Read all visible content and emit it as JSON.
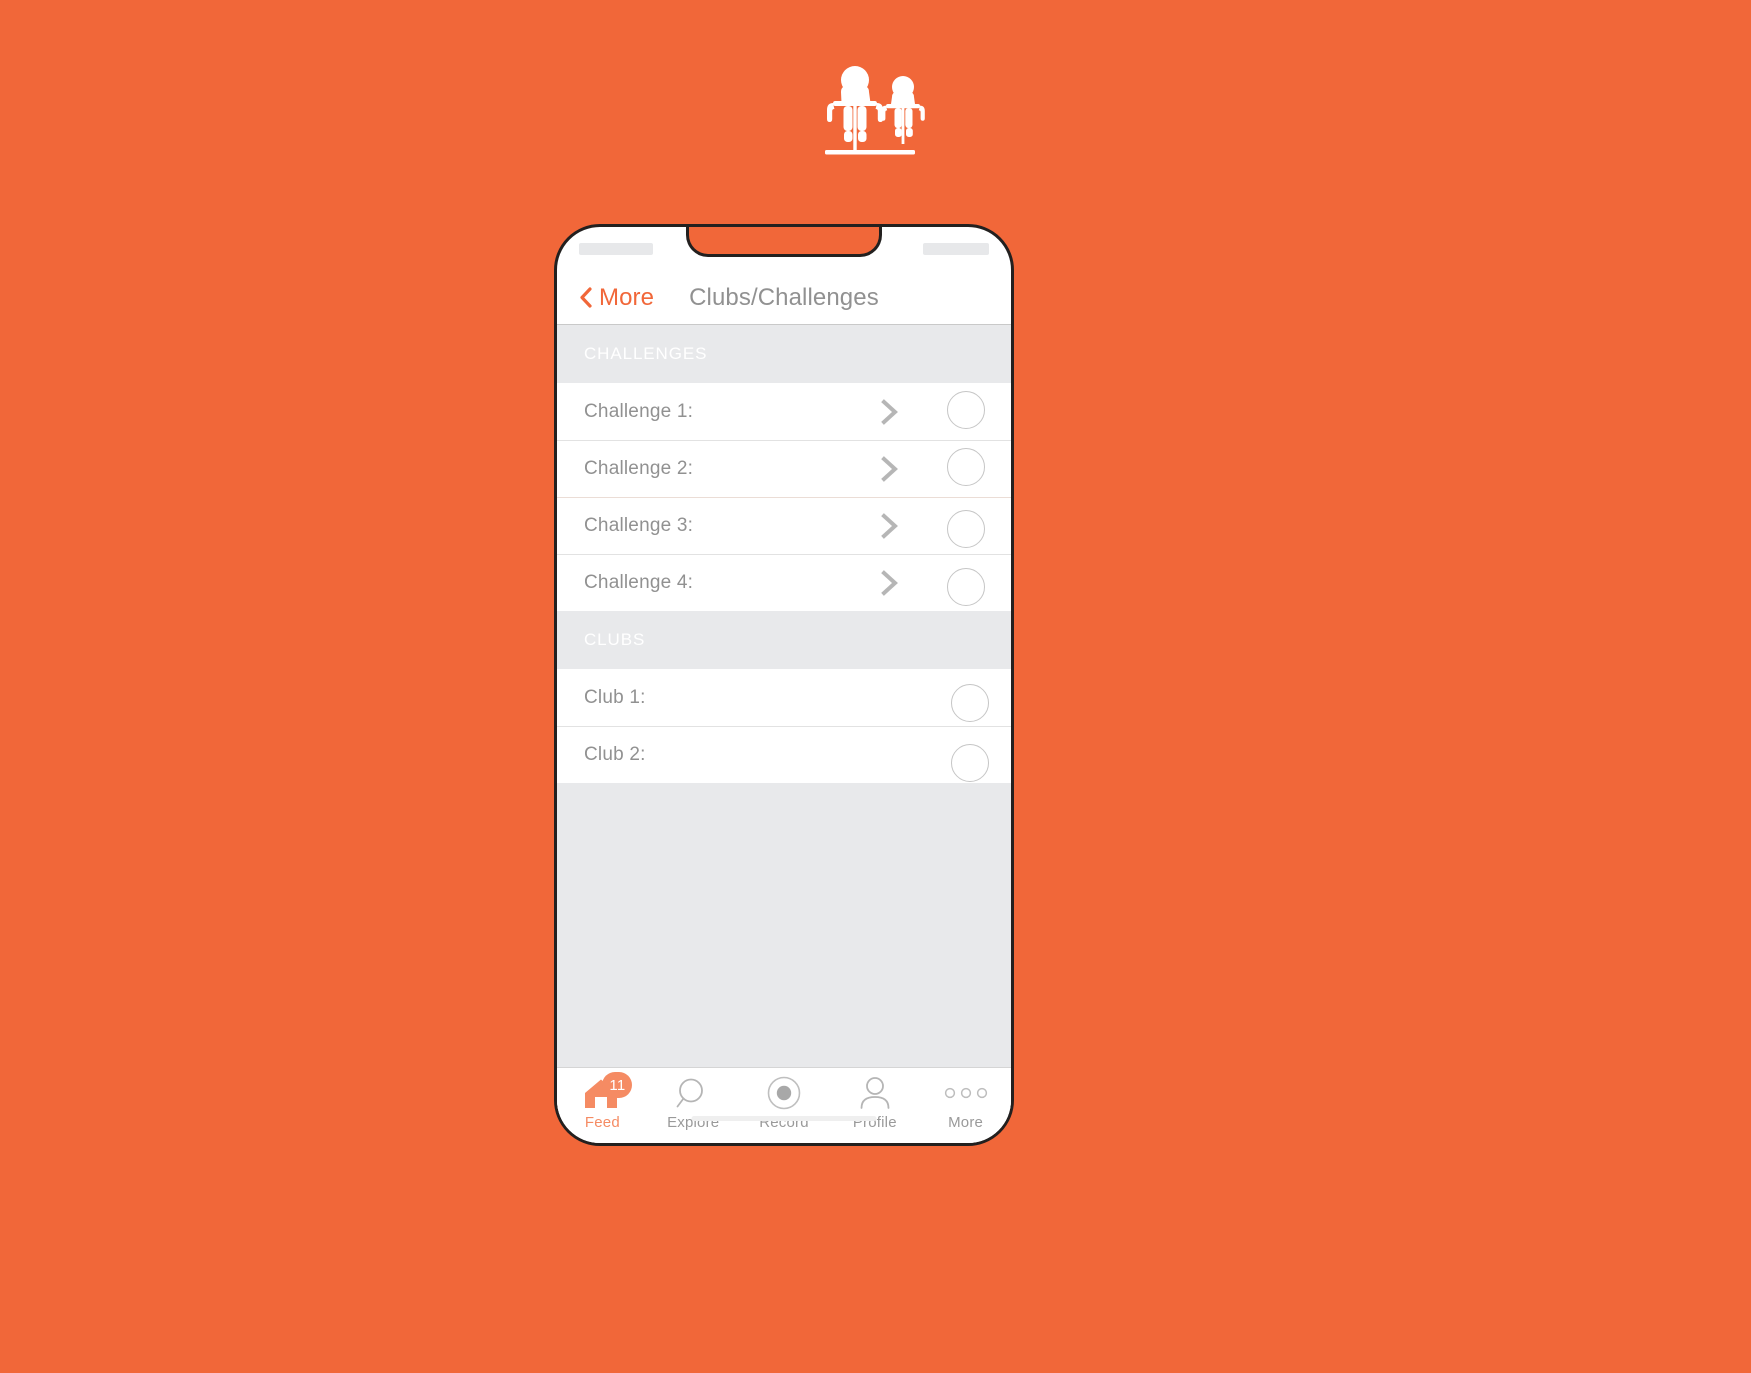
{
  "theme": {
    "background": "#F16739",
    "accent": "#F16739",
    "muted_text": "#919191",
    "section_bg": "#E8E9EB",
    "badge_color": "#F58B63"
  },
  "logo": {
    "name": "two-cyclists-logo",
    "alt": "Two cyclists riding side by side"
  },
  "phone": {
    "statusbar": {
      "left_placeholder": "",
      "right_placeholder": ""
    },
    "navbar": {
      "back_label": "More",
      "back_icon": "chevron-left-icon",
      "title": "Clubs/Challenges"
    },
    "sections": [
      {
        "id": "challenges",
        "header": "CHALLENGES",
        "rows": [
          {
            "label": "Challenge 1:",
            "chevron": true,
            "circle": true
          },
          {
            "label": "Challenge 2:",
            "chevron": true,
            "circle": true
          },
          {
            "label": "Challenge 3:",
            "chevron": true,
            "circle": true
          },
          {
            "label": "Challenge 4:",
            "chevron": true,
            "circle": true
          }
        ]
      },
      {
        "id": "clubs",
        "header": "CLUBS",
        "rows": [
          {
            "label": "Club 1:",
            "chevron": false,
            "circle": true
          },
          {
            "label": "Club 2:",
            "chevron": false,
            "circle": true
          }
        ]
      }
    ],
    "tabbar": {
      "tabs": [
        {
          "label": "Feed",
          "icon": "home-icon",
          "active": true,
          "badge": "11"
        },
        {
          "label": "Explore",
          "icon": "search-icon",
          "active": false,
          "badge": null
        },
        {
          "label": "Record",
          "icon": "record-icon",
          "active": false,
          "badge": null
        },
        {
          "label": "Profile",
          "icon": "person-icon",
          "active": false,
          "badge": null
        },
        {
          "label": "More",
          "icon": "ellipsis-icon",
          "active": false,
          "badge": null
        }
      ]
    }
  }
}
